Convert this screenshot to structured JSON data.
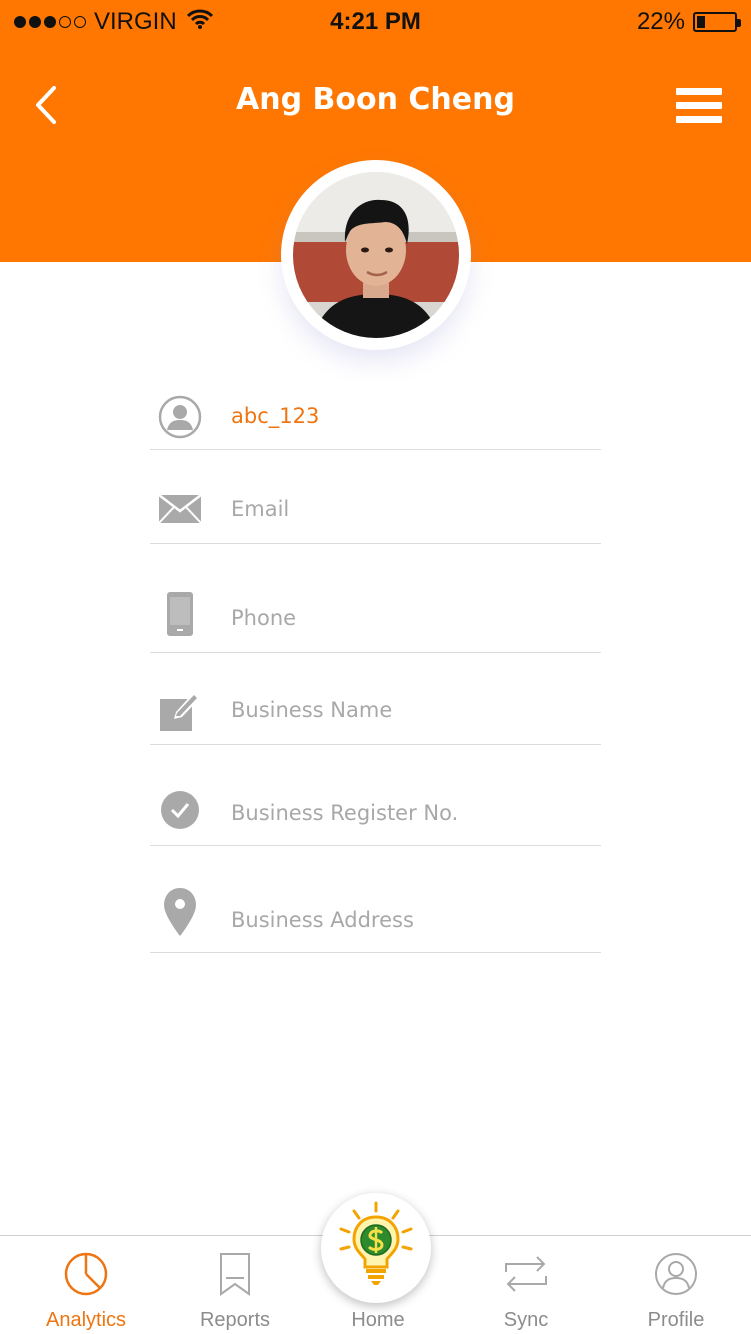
{
  "status_bar": {
    "signal_dots_filled": 3,
    "signal_dots_total": 5,
    "carrier": "VIRGIN",
    "wifi_icon": "wifi-icon",
    "time": "4:21 PM",
    "battery_percent_text": "22%",
    "battery_level": 0.22
  },
  "header": {
    "title": "Ang Boon Cheng",
    "back_icon": "chevron-left-icon",
    "menu_icon": "hamburger-menu-icon",
    "background_color": "#ff7700"
  },
  "profile": {
    "avatar_icon": "profile-photo"
  },
  "form": {
    "fields": [
      {
        "icon": "user-icon",
        "text": "abc_123",
        "is_value": true
      },
      {
        "icon": "envelope-icon",
        "text": "Email",
        "is_value": false
      },
      {
        "icon": "mobile-phone-icon",
        "text": "Phone",
        "is_value": false
      },
      {
        "icon": "edit-icon",
        "text": "Business Name",
        "is_value": false
      },
      {
        "icon": "checkmark-circle-icon",
        "text": "Business Register No.",
        "is_value": false
      },
      {
        "icon": "location-pin-icon",
        "text": "Business Address",
        "is_value": false
      }
    ]
  },
  "tab_bar": {
    "tabs": [
      {
        "label": "Analytics",
        "icon": "pie-chart-icon",
        "active": true
      },
      {
        "label": "Reports",
        "icon": "bookmark-icon",
        "active": false
      },
      {
        "label": "Home",
        "icon": "lightbulb-dollar-icon",
        "active": false
      },
      {
        "label": "Sync",
        "icon": "sync-arrows-icon",
        "active": false
      },
      {
        "label": "Profile",
        "icon": "user-circle-icon",
        "active": false
      }
    ]
  },
  "colors": {
    "accent": "#ee7511",
    "placeholder": "#a8a8a8",
    "icon_gray": "#a9a9a9",
    "divider": "#dcdcdc"
  }
}
